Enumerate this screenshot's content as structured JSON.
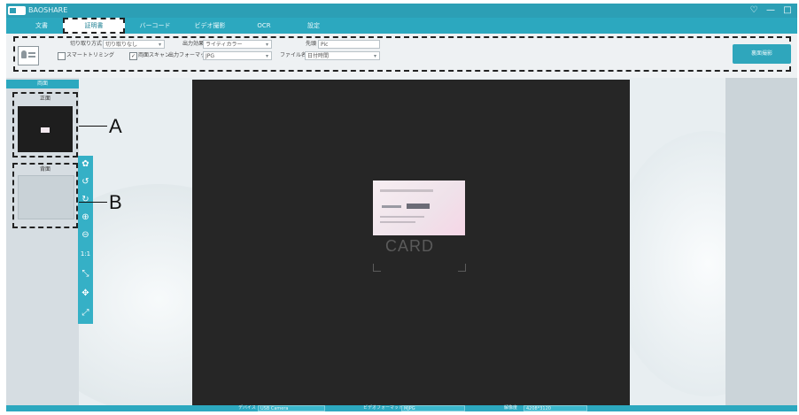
{
  "app": {
    "title": "BAOSHARE",
    "window_controls": [
      "♡",
      "—",
      "□"
    ]
  },
  "tabs": [
    {
      "label": "文書"
    },
    {
      "label": "証明書",
      "active": true
    },
    {
      "label": "バーコード"
    },
    {
      "label": "ビデオ撮影"
    },
    {
      "label": "OCR"
    },
    {
      "label": "設定"
    }
  ],
  "toolbar": {
    "crop_label": "切り取り方式",
    "crop_value": "切り取りなし",
    "output_effect_label": "出力効果",
    "output_effect_value": "ライティカラー",
    "prefix_label": "先頭",
    "prefix_value": "Pic",
    "smart_trim_label": "スマートトリミング",
    "duplex_scan_label": "両面スキャン",
    "duplex_checked": "✓",
    "output_format_label": "出力フォーマット",
    "output_format_value": "JPG",
    "filename_label": "ファイル名",
    "filename_value": "日付時間",
    "scan_button": "裏面撮影"
  },
  "left_panel": {
    "header": "両面",
    "front_label": "正面",
    "back_label": "背面"
  },
  "annotations": {
    "a": "A",
    "b": "B"
  },
  "tools": [
    "settings-icon",
    "rotate-left-icon",
    "rotate-right-icon",
    "zoom-in-icon",
    "zoom-out-icon",
    "actual-size-icon",
    "fit-window-icon",
    "crop-icon",
    "fullscreen-icon"
  ],
  "tool_glyphs": [
    "✿",
    "↺",
    "↻",
    "⊕",
    "⊖",
    "1:1",
    "⤡",
    "✥",
    "⤢"
  ],
  "preview": {
    "placeholder": "CARD"
  },
  "statusbar": {
    "device_label": "デバイス",
    "device_value": "USB Camera",
    "video_format_label": "ビデオフォーマット",
    "video_format_value": "MJPG",
    "resolution_label": "解像度",
    "resolution_value": "4208*3120"
  }
}
